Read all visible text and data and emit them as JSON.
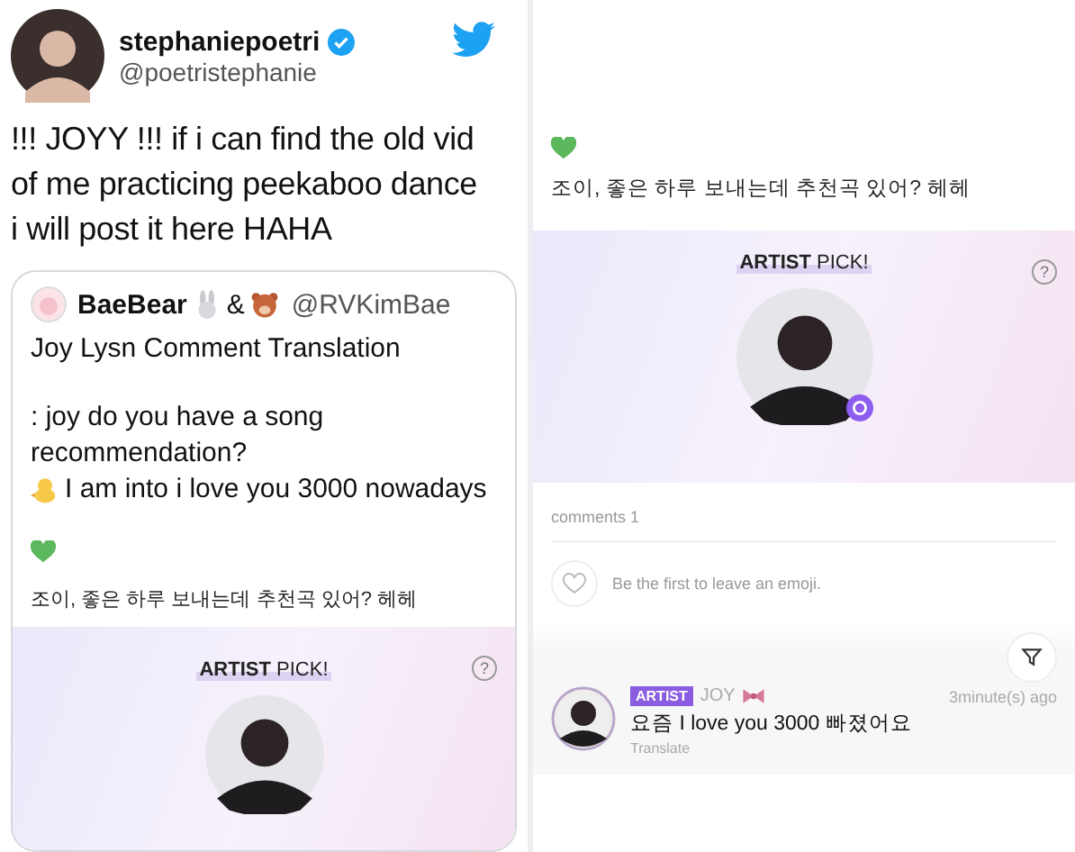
{
  "tweet": {
    "author": {
      "name": "stephaniepoetri",
      "handle": "@poetristephanie",
      "verified": true
    },
    "text": "!!! JOYY !!! if i can find the old vid of me practicing peekaboo dance i will post it here HAHA",
    "quote": {
      "author": {
        "name": "BaeBear",
        "joiner": "&",
        "handle": "@RVKimBae"
      },
      "title": "Joy Lysn Comment Translation",
      "lines": [
        ": joy do you have a song",
        "recommendation?",
        "I am into i love you 3000 nowadays"
      ],
      "post_text": "조이, 좋은 하루 보내는데 추천곡 있어? 헤헤",
      "banner_label": "**ARTIST** PICK!",
      "help": "?"
    }
  },
  "post": {
    "text": "조이, 좋은 하루 보내는데 추천곡 있어? 헤헤",
    "banner_label": "**ARTIST** PICK!",
    "help": "?"
  },
  "comments": {
    "count_label": "comments 1",
    "emoji_prompt": "Be the first to leave an emoji.",
    "items": [
      {
        "badge": "ARTIST",
        "author": "JOY",
        "time": "3minute(s) ago",
        "text": "요즘 I love you 3000 빠졌어요",
        "action": "Translate"
      }
    ]
  }
}
